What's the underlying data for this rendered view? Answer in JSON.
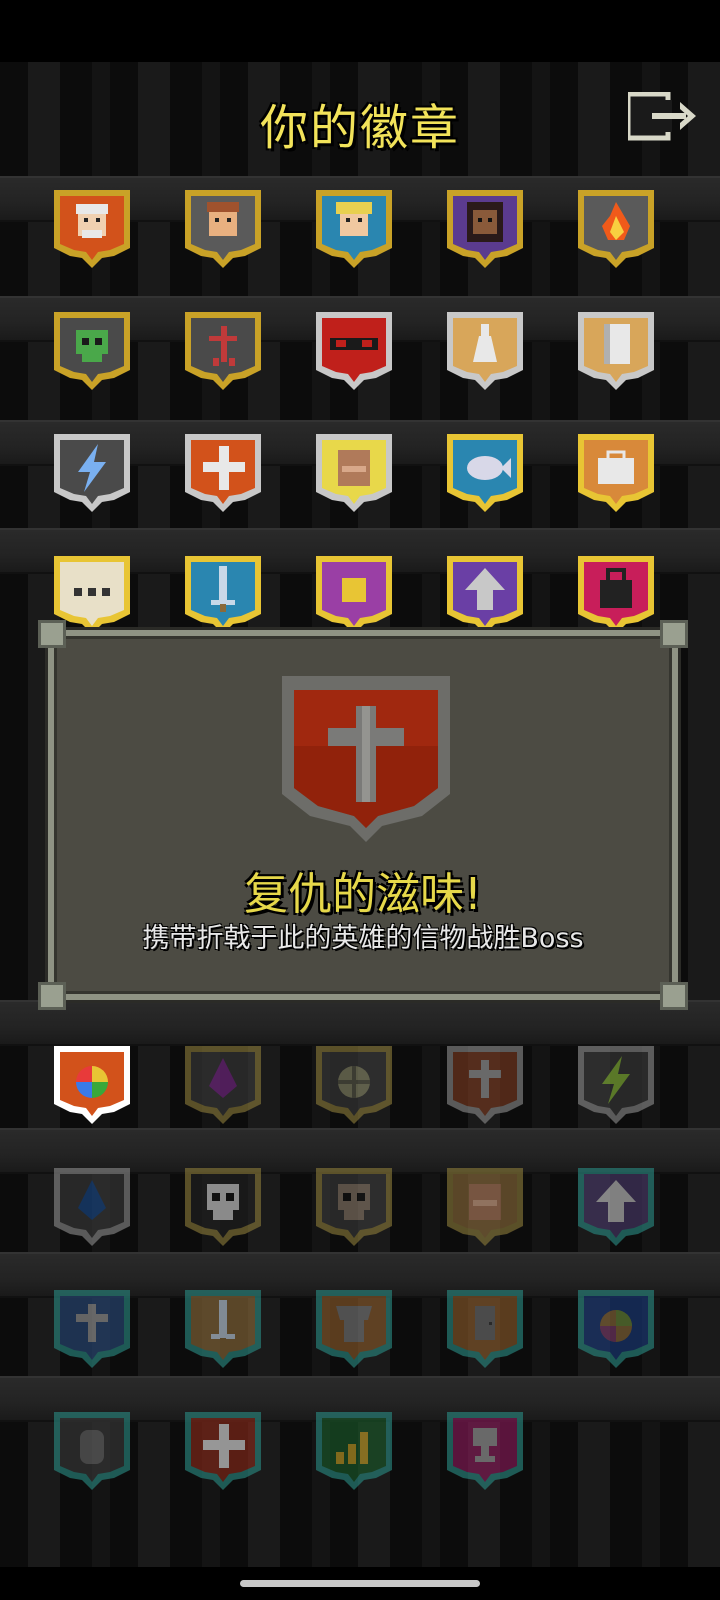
{
  "title": "你的徽章",
  "exit_icon": "exit-arrow-icon",
  "colors": {
    "title": "#f2e35a",
    "gold": "#c9a227",
    "silver": "#c8c8c8",
    "teal": "#2fa39a",
    "panel": "#4c4b43"
  },
  "badges": [
    {
      "row": 0,
      "col": 0,
      "icon": "warrior-face",
      "frame": "#c9a227",
      "bg": "#d2521b",
      "dim": false
    },
    {
      "row": 0,
      "col": 1,
      "icon": "mage-face",
      "frame": "#c9a227",
      "bg": "#5a5a5a",
      "dim": false
    },
    {
      "row": 0,
      "col": 2,
      "icon": "rogue-face",
      "frame": "#c9a227",
      "bg": "#2a86b0",
      "dim": false
    },
    {
      "row": 0,
      "col": 3,
      "icon": "huntress-face",
      "frame": "#c9a227",
      "bg": "#5b3b8f",
      "dim": false
    },
    {
      "row": 0,
      "col": 4,
      "icon": "fire",
      "frame": "#c9a227",
      "bg": "#5a5a5a",
      "dim": false
    },
    {
      "row": 1,
      "col": 0,
      "icon": "skull-green",
      "frame": "#c9a227",
      "bg": "#4a4a4a",
      "dim": false
    },
    {
      "row": 1,
      "col": 1,
      "icon": "stickman",
      "frame": "#c9a227",
      "bg": "#4a4a4a",
      "dim": false
    },
    {
      "row": 1,
      "col": 2,
      "icon": "mask",
      "frame": "#c8c8c8",
      "bg": "#c0201b",
      "dim": false
    },
    {
      "row": 1,
      "col": 3,
      "icon": "potion",
      "frame": "#c8c8c8",
      "bg": "#d8a65a",
      "dim": false
    },
    {
      "row": 1,
      "col": 4,
      "icon": "scroll",
      "frame": "#c8c8c8",
      "bg": "#d8a65a",
      "dim": false
    },
    {
      "row": 2,
      "col": 0,
      "icon": "lightning",
      "frame": "#c8c8c8",
      "bg": "#4a4a4a",
      "dim": false
    },
    {
      "row": 2,
      "col": 1,
      "icon": "plus",
      "frame": "#c8c8c8",
      "bg": "#d2521b",
      "dim": false
    },
    {
      "row": 2,
      "col": 2,
      "icon": "book",
      "frame": "#c8c8c8",
      "bg": "#e8d84a",
      "dim": false
    },
    {
      "row": 2,
      "col": 3,
      "icon": "fish",
      "frame": "#e8c534",
      "bg": "#2a86b0",
      "dim": false
    },
    {
      "row": 2,
      "col": 4,
      "icon": "briefcase",
      "frame": "#e8c534",
      "bg": "#d8893a",
      "dim": false
    },
    {
      "row": 3,
      "col": 0,
      "icon": "dots",
      "frame": "#e8c534",
      "bg": "#e8e0c8",
      "dim": false
    },
    {
      "row": 3,
      "col": 1,
      "icon": "sword",
      "frame": "#e8c534",
      "bg": "#2a86b0",
      "dim": false
    },
    {
      "row": 3,
      "col": 2,
      "icon": "coin",
      "frame": "#e8c534",
      "bg": "#9a3fa5",
      "dim": false
    },
    {
      "row": 3,
      "col": 3,
      "icon": "arrow-up",
      "frame": "#e8c534",
      "bg": "#6a3fa5",
      "dim": false
    },
    {
      "row": 3,
      "col": 4,
      "icon": "bag",
      "frame": "#e8c534",
      "bg": "#c81e5a",
      "dim": false
    },
    {
      "row": 5,
      "col": 0,
      "icon": "rainbow-orb",
      "frame": "#ffffff",
      "bg": "#d2521b",
      "dim": false
    },
    {
      "row": 5,
      "col": 1,
      "icon": "drop-purple",
      "frame": "#8a7a3a",
      "bg": "#3a3a3a",
      "dim": true
    },
    {
      "row": 5,
      "col": 2,
      "icon": "crosshair",
      "frame": "#8a7a3a",
      "bg": "#3a3a3a",
      "dim": true
    },
    {
      "row": 5,
      "col": 3,
      "icon": "cross",
      "frame": "#8a8a8a",
      "bg": "#7a3a20",
      "dim": true
    },
    {
      "row": 5,
      "col": 4,
      "icon": "lightning-green",
      "frame": "#8a8a8a",
      "bg": "#3a3a3a",
      "dim": true
    },
    {
      "row": 6,
      "col": 0,
      "icon": "drop-blue",
      "frame": "#8a8a8a",
      "bg": "#3a3a3a",
      "dim": true
    },
    {
      "row": 6,
      "col": 1,
      "icon": "skull",
      "frame": "#8a7a3a",
      "bg": "#222",
      "dim": true
    },
    {
      "row": 6,
      "col": 2,
      "icon": "skull-brown",
      "frame": "#8a7a3a",
      "bg": "#3a3a3a",
      "dim": true
    },
    {
      "row": 6,
      "col": 3,
      "icon": "book-dim",
      "frame": "#8a7a3a",
      "bg": "#8a6a3a",
      "dim": true
    },
    {
      "row": 6,
      "col": 4,
      "icon": "arrow-up-dim",
      "frame": "#2a8a82",
      "bg": "#4a3a6a",
      "dim": true
    },
    {
      "row": 7,
      "col": 0,
      "icon": "cross-blue",
      "frame": "#2a8a82",
      "bg": "#2a4a7a",
      "dim": true
    },
    {
      "row": 7,
      "col": 1,
      "icon": "sword-dim",
      "frame": "#2a8a82",
      "bg": "#8a6a3a",
      "dim": true
    },
    {
      "row": 7,
      "col": 2,
      "icon": "armor",
      "frame": "#2a8a82",
      "bg": "#8a5a2a",
      "dim": true
    },
    {
      "row": 7,
      "col": 3,
      "icon": "door",
      "frame": "#2a8a82",
      "bg": "#8a5a2a",
      "dim": true
    },
    {
      "row": 7,
      "col": 4,
      "icon": "orb",
      "frame": "#2a8a82",
      "bg": "#1a3a7a",
      "dim": true
    },
    {
      "row": 8,
      "col": 0,
      "icon": "tombstone",
      "frame": "#2a8a82",
      "bg": "#3a3a3a",
      "dim": true
    },
    {
      "row": 8,
      "col": 1,
      "icon": "plus-dim",
      "frame": "#2a8a82",
      "bg": "#8a2a1a",
      "dim": true
    },
    {
      "row": 8,
      "col": 2,
      "icon": "chart",
      "frame": "#2a8a82",
      "bg": "#1a5a2a",
      "dim": true
    },
    {
      "row": 8,
      "col": 3,
      "icon": "trophy",
      "frame": "#2a8a82",
      "bg": "#8a1a5a",
      "dim": true
    }
  ],
  "popup": {
    "title": "复仇的滋味!",
    "description": "携带折戟于此的英雄的信物战胜Boss",
    "icon": "cross-shield-icon"
  }
}
